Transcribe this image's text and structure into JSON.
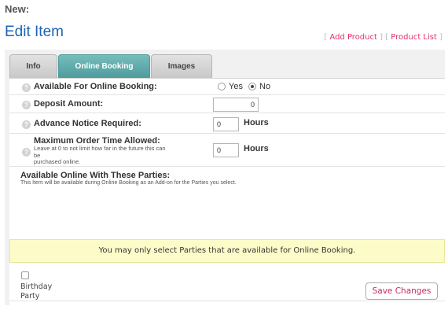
{
  "heading_new": "New:",
  "page_title": "Edit Item",
  "header_links": {
    "open_bracket": "[ ",
    "add_product": "Add Product",
    "separator": " ] [ ",
    "product_list": "Product List",
    "close_bracket": " ]"
  },
  "tabs": [
    {
      "label": "Info",
      "active": false
    },
    {
      "label": "Online Booking",
      "active": true
    },
    {
      "label": "Images",
      "active": false
    }
  ],
  "form": {
    "available": {
      "label": "Available For Online Booking:",
      "options": [
        {
          "label": "Yes",
          "selected": false
        },
        {
          "label": "No",
          "selected": true
        }
      ]
    },
    "deposit": {
      "label": "Deposit Amount:",
      "value": "0"
    },
    "advance": {
      "label": "Advance Notice Required:",
      "value": "0",
      "unit": "Hours"
    },
    "max_order": {
      "label": "Maximum Order Time Allowed:",
      "help_line1": "Leave at 0 to not limit how far in the future this can",
      "help_line2": "be",
      "help_line3": "purchased online.",
      "value": "0",
      "unit": "Hours"
    }
  },
  "parties": {
    "heading": "Available Online With These Parties:",
    "description": "This Item will be available during Online Booking as an Add-on for the Parties you select.",
    "notice": "You may only select Parties that are available for Online Booking.",
    "items": [
      {
        "label": "Birthday Party",
        "checked": false
      }
    ]
  },
  "save_button": "Save Changes",
  "icons": {
    "help": "question-circle-icon"
  },
  "colors": {
    "title": "#1c63b7",
    "link": "#e0356a",
    "active_tab": "#4f9b9c",
    "notice_bg": "#fdfcc9",
    "save_text": "#c62a5f"
  }
}
